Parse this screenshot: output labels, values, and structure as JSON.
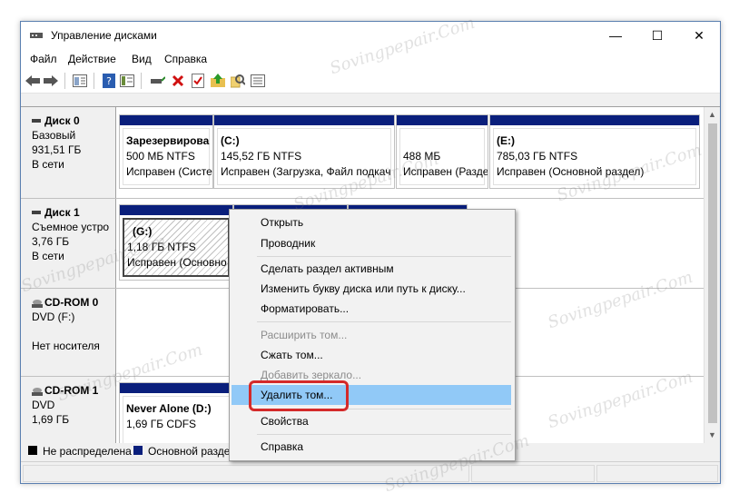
{
  "window": {
    "title": "Управление дисками",
    "controls": {
      "minimize": "—",
      "maximize": "☐",
      "close": "✕"
    }
  },
  "menubar": {
    "items": [
      "Файл",
      "Действие",
      "Вид",
      "Справка"
    ]
  },
  "toolbar": {
    "icons": [
      "back-arrow-icon",
      "forward-arrow-icon",
      "show-hide-tree-icon",
      "help-icon",
      "properties-icon",
      "connect-drive-icon",
      "delete-icon",
      "checklist-icon",
      "up-folder-icon",
      "find-icon",
      "list-view-icon"
    ]
  },
  "disks": [
    {
      "name": "Диск 0",
      "type": "Базовый",
      "size": "931,51 ГБ",
      "status": "В сети",
      "partitions": [
        {
          "name": "Зарезервирова",
          "info": "500 МБ NTFS",
          "status": "Исправен (Систе"
        },
        {
          "name": "(C:)",
          "info": "145,52 ГБ NTFS",
          "status": "Исправен (Загрузка, Файл подкач"
        },
        {
          "name": "",
          "info": "488 МБ",
          "status": "Исправен (Разде"
        },
        {
          "name": "(E:)",
          "info": "785,03 ГБ NTFS",
          "status": "Исправен (Основной раздел)"
        }
      ]
    },
    {
      "name": "Диск 1",
      "type": "Съемное устро",
      "size": "3,76 ГБ",
      "status": "В сети",
      "partitions": [
        {
          "name": "(G:)",
          "info": "1,18 ГБ NTFS",
          "status": "Исправен (Основно"
        }
      ]
    },
    {
      "name": "CD-ROM 0",
      "type": "DVD (F:)",
      "size": "",
      "status": "Нет носителя",
      "partitions": []
    },
    {
      "name": "CD-ROM 1",
      "type": "DVD",
      "size": "1,69 ГБ",
      "status": "",
      "partitions": [
        {
          "name": "Never Alone (D:)",
          "info": "1,69 ГБ CDFS",
          "status": ""
        }
      ]
    }
  ],
  "legend": {
    "unallocated": "Не распределена",
    "primary": "Основной разде",
    "colors": {
      "unallocated": "#000000",
      "primary": "#0a1f7c"
    }
  },
  "context_menu": {
    "items": [
      {
        "label": "Открыть",
        "enabled": true
      },
      {
        "label": "Проводник",
        "enabled": true
      },
      {
        "label": "Сделать раздел активным",
        "enabled": true
      },
      {
        "label": "Изменить букву диска или путь к диску...",
        "enabled": true
      },
      {
        "label": "Форматировать...",
        "enabled": true
      },
      {
        "label": "Расширить том...",
        "enabled": false
      },
      {
        "label": "Сжать том...",
        "enabled": true
      },
      {
        "label": "Добавить зеркало...",
        "enabled": false
      },
      {
        "label": "Удалить том...",
        "enabled": true,
        "highlighted": true
      },
      {
        "label": "Свойства",
        "enabled": true
      },
      {
        "label": "Справка",
        "enabled": true
      }
    ],
    "highlight_color": "#91c9f7",
    "callout_color": "#d42a2a"
  },
  "watermark": "Sovingpepair.Com"
}
